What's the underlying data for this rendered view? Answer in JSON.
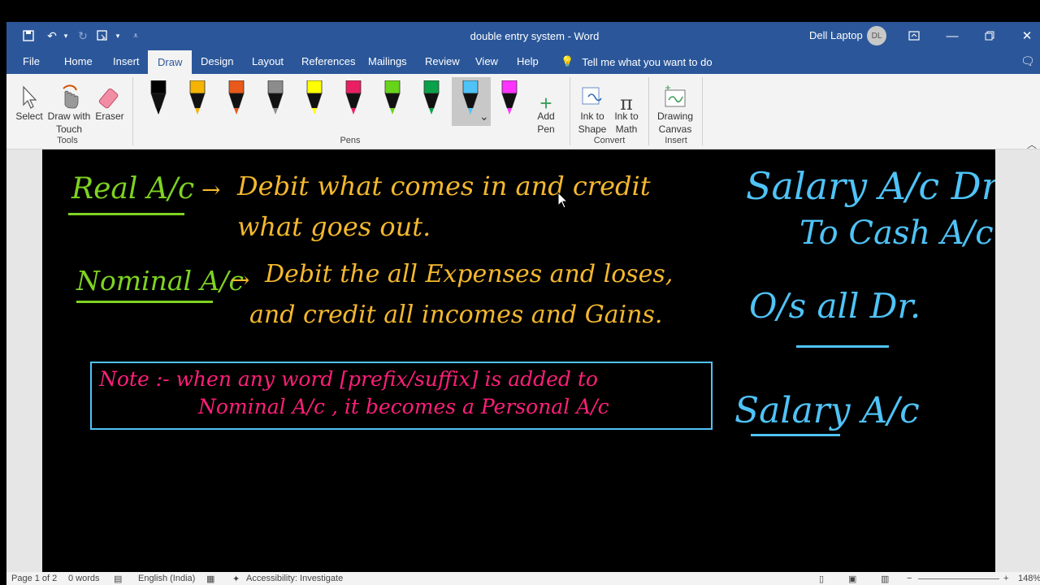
{
  "window": {
    "title": "double entry system  -  Word",
    "user_name": "Dell Laptop",
    "user_initials": "DL"
  },
  "menu_tabs": [
    "File",
    "Home",
    "Insert",
    "Draw",
    "Design",
    "Layout",
    "References",
    "Mailings",
    "Review",
    "View",
    "Help"
  ],
  "tell_me": "Tell me what you want to do",
  "ribbon": {
    "tools": {
      "select": "Select",
      "draw_touch_1": "Draw with",
      "draw_touch_2": "Touch",
      "eraser": "Eraser",
      "group": "Tools"
    },
    "pens_group": "Pens",
    "pens": [
      {
        "color": "#000000"
      },
      {
        "color": "#f4b400"
      },
      {
        "color": "#e8591a"
      },
      {
        "color": "#8c8c8c"
      },
      {
        "color": "#ffff00"
      },
      {
        "color": "#e91e63"
      },
      {
        "color": "#66d41a"
      },
      {
        "color": "#0aa14a"
      },
      {
        "color": "#4fc3f7"
      },
      {
        "color": "#ff33ff"
      }
    ],
    "add_pen_1": "Add",
    "add_pen_2": "Pen",
    "convert": {
      "ink_shape_1": "Ink to",
      "ink_shape_2": "Shape",
      "ink_math_1": "Ink to",
      "ink_math_2": "Math",
      "group": "Convert"
    },
    "insert": {
      "canvas_1": "Drawing",
      "canvas_2": "Canvas",
      "group": "Insert"
    }
  },
  "ink": {
    "real_label": "Real A/c",
    "real_line1": "Debit what comes in and credit",
    "real_line2": "what goes out.",
    "nominal_label": "Nominal A/c",
    "nominal_line1": "Debit the all Expenses and loses,",
    "nominal_line2": "and credit all incomes and Gains.",
    "note_line1": "Note :-   when any word [prefix/suffix] is added to",
    "note_line2": "Nominal  A/c ,  it  becomes  a  Personal  A/c",
    "right_line1": "Salary A/c Dr",
    "right_line2": "To Cash A/c",
    "right_line3": "O/s all Dr.",
    "right_line4": "Salary  A/c",
    "colors": {
      "green": "#7ed321",
      "orange": "#f5b82e",
      "pink": "#ff1f7a",
      "blue": "#4fc3f7"
    }
  },
  "status_bar": {
    "page": "Page 1 of 2",
    "words": "0 words",
    "language": "English (India)",
    "accessibility": "Accessibility: Investigate",
    "zoom": "148%"
  }
}
